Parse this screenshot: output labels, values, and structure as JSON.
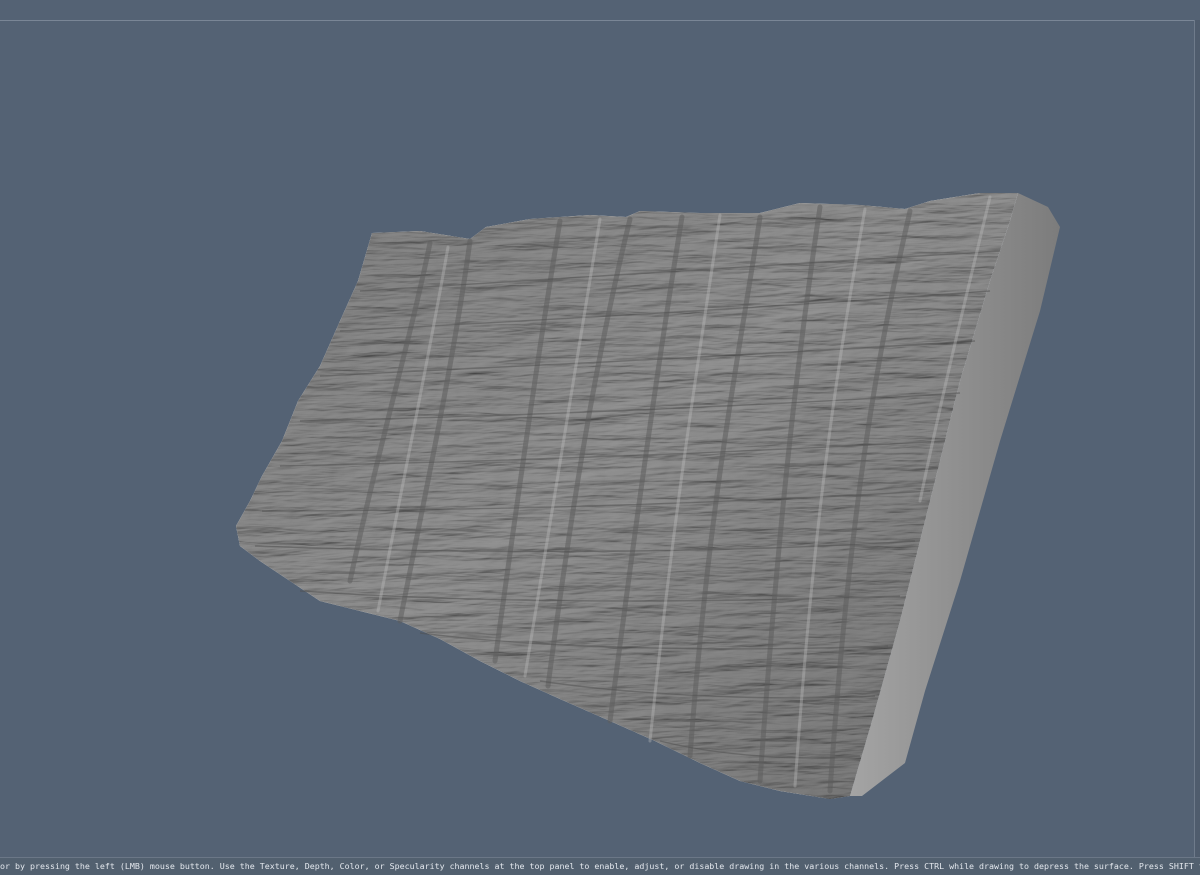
{
  "status_bar": {
    "hint_text": "or by pressing the left (LMB) mouse button. Use the Texture, Depth, Color, or Specularity channels at the top panel to enable, adjust, or disable drawing in the various channels. Press CTRL while drawing to depress the surface. Press SHIFT to smooth the active channel(s) while you draw. Navigate the camera with"
  },
  "colors": {
    "viewport_background": "#546274",
    "model_surface": "#8c8c8c",
    "model_side": "#9a9a9a"
  },
  "viewport": {
    "object": "sculpted-rock-cliff-slab"
  }
}
